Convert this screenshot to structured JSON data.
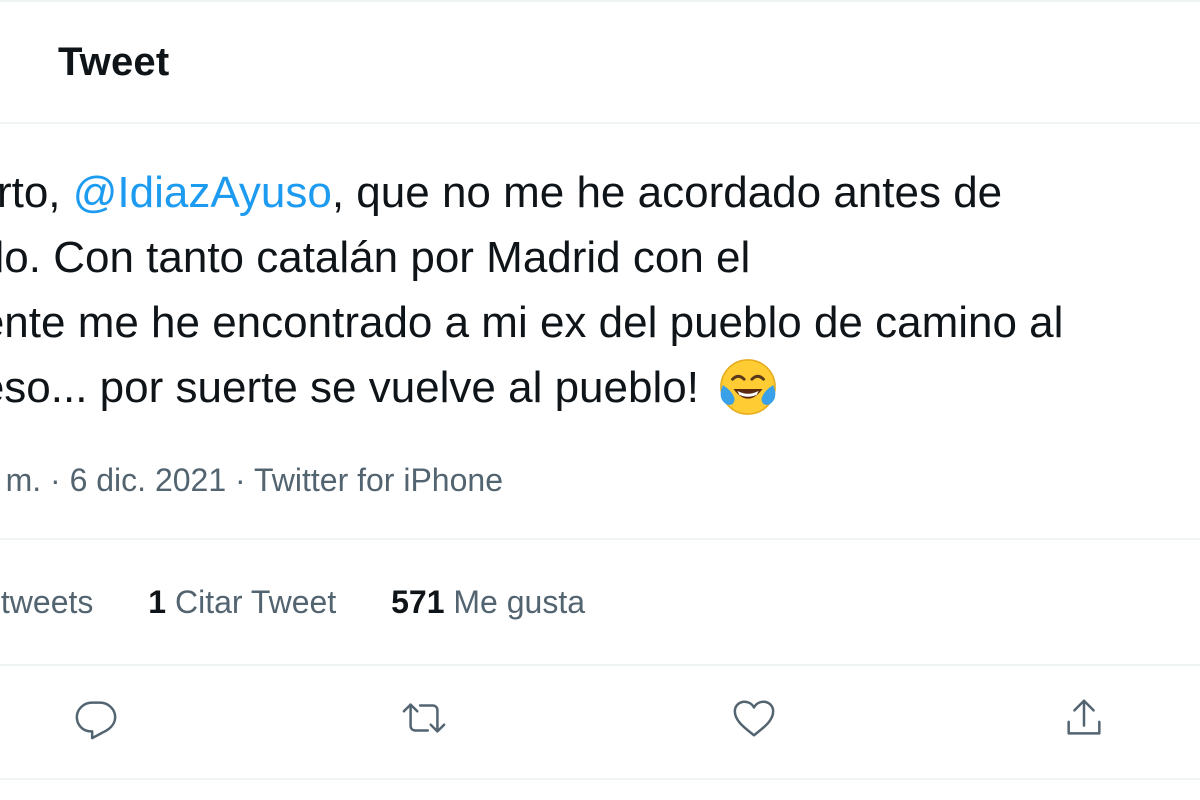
{
  "header": {
    "title": "Tweet"
  },
  "tweet": {
    "line1_before": "Por cierto, ",
    "mention": "@IdiazAyuso",
    "line1_after": ", que no me he acordado antes de",
    "line2": "decírtelo. Con tanto catalán por Madrid con el",
    "line3": "presidente me he encontrado a mi ex del pueblo de camino al",
    "line4": "Congreso... por suerte se vuelve al pueblo! ",
    "emoji": "face-with-tears-of-joy"
  },
  "meta": {
    "time": "p. m.",
    "dot1": " · ",
    "date": "6 dic. 2021",
    "dot2": " · ",
    "source": "Twitter for iPhone"
  },
  "stats": {
    "retweets_label": "Retweets",
    "quotes_count": "1",
    "quotes_label": "Citar Tweet",
    "likes_count": "571",
    "likes_label": "Me gusta"
  },
  "actions": {
    "reply_icon": "reply-icon",
    "retweet_icon": "retweet-icon",
    "like_icon": "heart-icon",
    "share_icon": "share-icon"
  },
  "colors": {
    "mention": "#1d9bf0",
    "text": "#0f1419",
    "secondary": "#536471",
    "divider": "#eff3f4"
  }
}
